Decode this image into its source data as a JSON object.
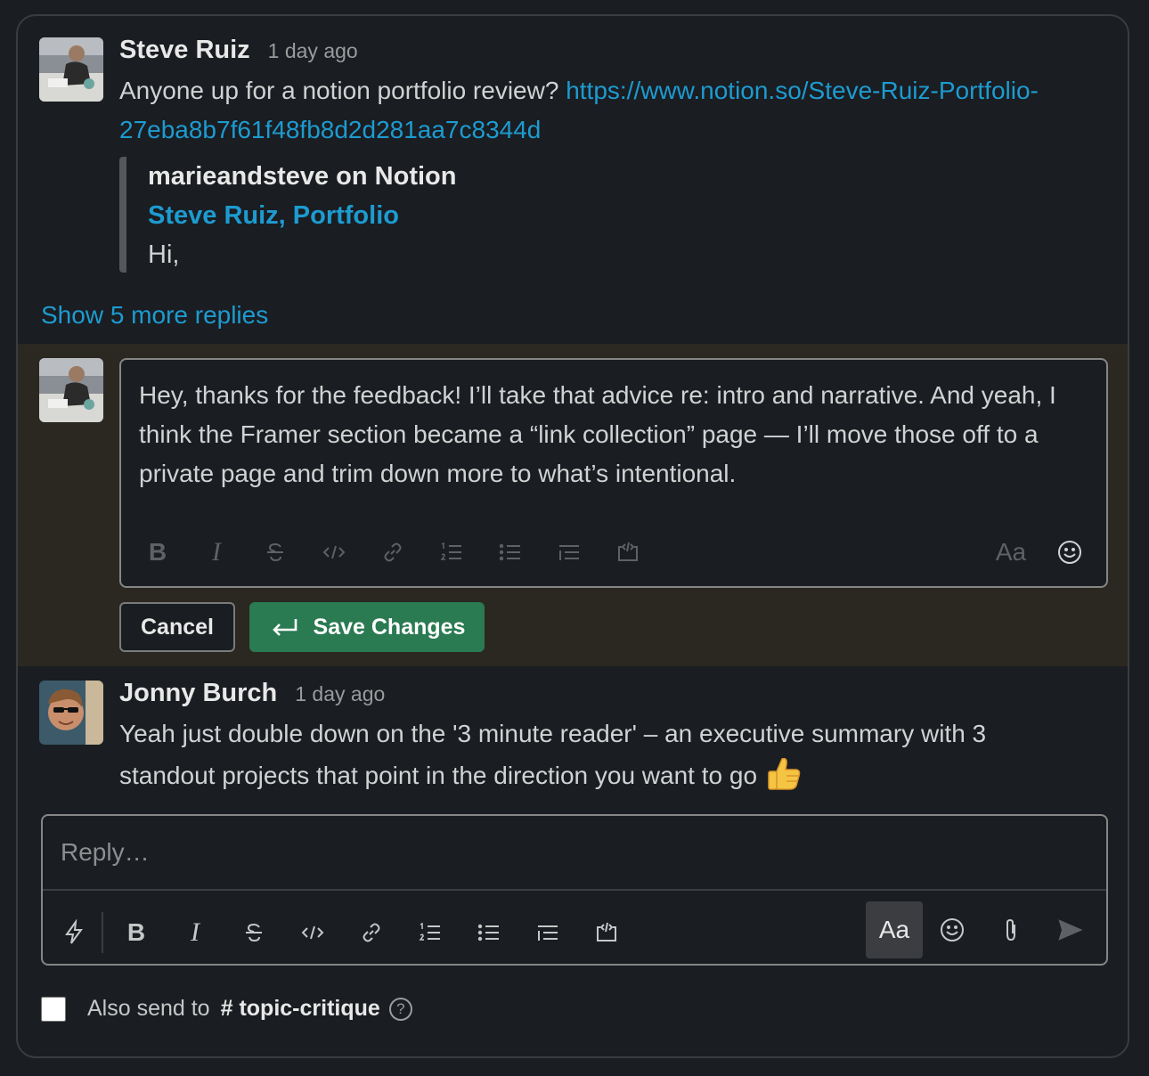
{
  "messages": [
    {
      "author": "Steve Ruiz",
      "time": "1 day ago",
      "text": "Anyone up for a notion portfolio review?",
      "link": "https://www.notion.so/Steve-Ruiz-Portfolio-27eba8b7f61f48fb8d2d281aa7c8344d",
      "unfurl": {
        "service": "marieandsteve on Notion",
        "title": "Steve Ruiz, Portfolio",
        "description": "Hi,"
      }
    },
    {
      "author": "Jonny Burch",
      "time": "1 day ago",
      "text": "Yeah just double down on the '3 minute reader' – an executive summary with 3 standout projects that point in the direction you want to go",
      "emoji": "thumbs-up"
    }
  ],
  "show_more": "Show 5 more replies",
  "editor": {
    "text": "Hey, thanks for the feedback! I’ll take that advice re: intro and narrative. And yeah, I think the Framer section became a “link collection” page — I’ll move those off to a private page and trim down more to what’s intentional.",
    "format_bold": "B",
    "format_italic": "I",
    "format_text": "Aa",
    "cancel_label": "Cancel",
    "save_label": "Save Changes"
  },
  "reply": {
    "placeholder": "Reply…",
    "format_bold": "B",
    "format_italic": "I",
    "format_text": "Aa"
  },
  "also_send": {
    "label": "Also send to",
    "hash": "#",
    "channel": "topic-critique",
    "help": "?",
    "checked": false
  },
  "colors": {
    "background": "#1a1d21",
    "link": "#1d9bd1",
    "save_button": "#2a7a52",
    "edit_highlight": "#2a2820"
  }
}
